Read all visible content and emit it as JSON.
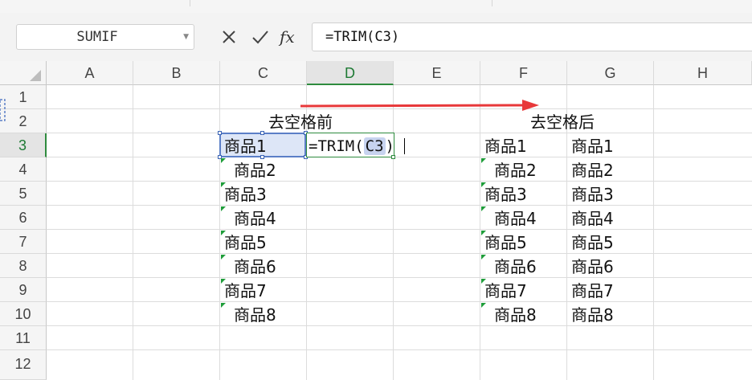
{
  "name_box": {
    "value": "SUMIF"
  },
  "formula_bar": {
    "cancel_icon": "x-icon",
    "confirm_icon": "check-icon",
    "fx_label": "fx",
    "formula": "=TRIM(C3)"
  },
  "columns": [
    "A",
    "B",
    "C",
    "D",
    "E",
    "F",
    "G",
    "H"
  ],
  "rows": [
    "1",
    "2",
    "3",
    "4",
    "5",
    "6",
    "7",
    "8",
    "9",
    "10",
    "11",
    "12"
  ],
  "active_column": "D",
  "active_row": "3",
  "headers": {
    "before": "去空格前",
    "after": "去空格后"
  },
  "colors": {
    "selection": "#dde6f7",
    "accent_green": "#2e8b3e",
    "arrow_red": "#e8383a"
  },
  "cells": {
    "C3": "商品1",
    "C4": "  商品2",
    "C5": "商品3",
    "C6": "  商品4",
    "C7": "商品5",
    "C8": "  商品6",
    "C9": "商品7",
    "C10": "  商品8",
    "F3": "商品1",
    "F4": "  商品2",
    "F5": "商品3",
    "F6": "  商品4",
    "F7": "商品5",
    "F8": "  商品6",
    "F9": "商品7",
    "F10": "  商品8",
    "G3": "商品1",
    "G4": "商品2",
    "G5": "商品3",
    "G6": "商品4",
    "G7": "商品5",
    "G8": "商品6",
    "G9": "商品7",
    "G10": "商品8"
  },
  "editing": {
    "cell": "D3",
    "prefix": "=TRIM(",
    "ref": "C3",
    "suffix": ")"
  }
}
